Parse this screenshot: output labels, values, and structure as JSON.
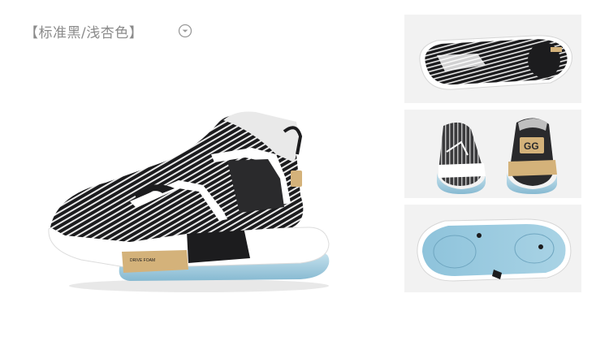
{
  "product": {
    "color_option_label": "【标准黑/浅杏色】",
    "dropdown_icon": "chevron-down-circle-icon",
    "main_image_text": "DRIVE FOAM",
    "thumbnails": [
      {
        "name": "top-view"
      },
      {
        "name": "front-back-view"
      },
      {
        "name": "sole-view"
      }
    ],
    "colors": {
      "upper": "#1c1c1e",
      "stripe": "#e9e9e9",
      "accent_gold": "#d4b27a",
      "midsole": "#ffffff",
      "outsole_ice": "#9ccbe0",
      "thumb_bg": "#f2f2f2"
    }
  }
}
